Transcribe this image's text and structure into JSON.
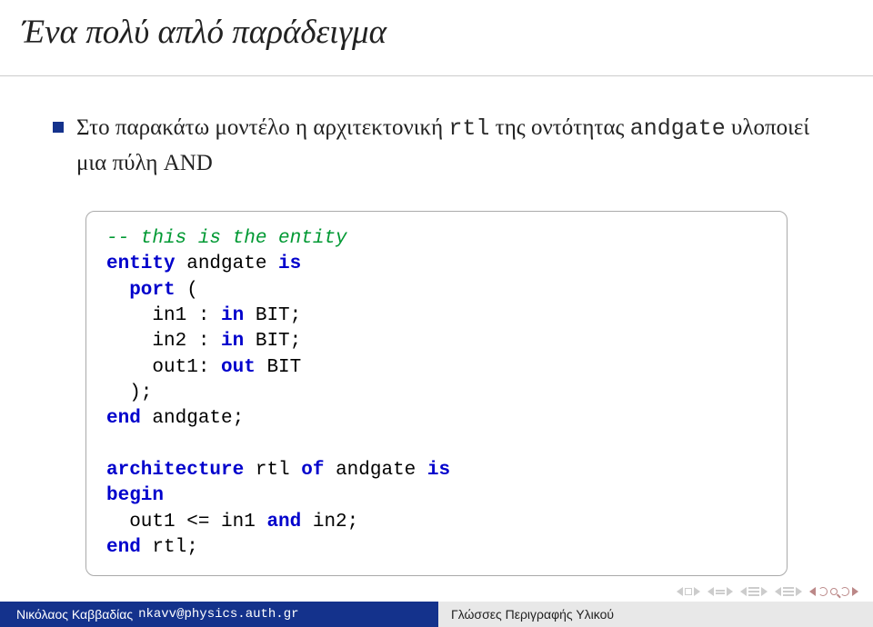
{
  "title": "Ένα πολύ απλό παράδειγμα",
  "bullet": {
    "pre": "Στο παρακάτω μοντέλο η αρχιτεκτονική ",
    "code1": "rtl",
    "mid": " της οντότητας ",
    "code2": "andgate",
    "post": " υλοποιεί μια πύλη AND"
  },
  "code": {
    "l1_comment": "-- this is the entity",
    "l2_k1": "entity",
    "l2_t": " andgate ",
    "l2_k2": "is",
    "l3_k1": "  port",
    "l3_t": " (",
    "l4_t1": "    in1 : ",
    "l4_k": "in",
    "l4_t2": " BIT;",
    "l5_t1": "    in2 : ",
    "l5_k": "in",
    "l5_t2": " BIT;",
    "l6_t1": "    out1: ",
    "l6_k": "out",
    "l6_t2": " BIT",
    "l7_t": "  );",
    "l8_k": "end",
    "l8_t": " andgate;",
    "blank": " ",
    "l9_k1": "architecture",
    "l9_t1": " rtl ",
    "l9_k2": "of",
    "l9_t2": " andgate ",
    "l9_k3": "is",
    "l10_k": "begin",
    "l11_t1": "  out1 <= in1 ",
    "l11_k": "and",
    "l11_t2": " in2;",
    "l12_k": "end",
    "l12_t": " rtl;"
  },
  "footer": {
    "author": "Νικόλαος Καββαδίας",
    "email": "nkavv@physics.auth.gr",
    "right": "Γλώσσες Περιγραφής Υλικού"
  }
}
